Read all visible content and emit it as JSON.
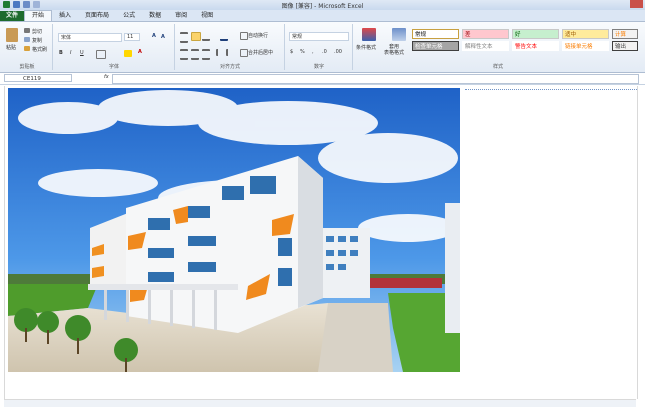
{
  "window": {
    "title": "图像 [兼容] - Microsoft Excel"
  },
  "tabs": [
    "文件",
    "开始",
    "插入",
    "页面布局",
    "公式",
    "数据",
    "审阅",
    "视图"
  ],
  "ribbon": {
    "clipboard": {
      "paste": "粘贴",
      "cut": "剪切",
      "copy": "复制",
      "format_painter": "格式刷",
      "label": "剪贴板"
    },
    "font": {
      "name": "宋体",
      "size": "11",
      "label": "字体"
    },
    "alignment": {
      "wrap": "自动换行",
      "merge": "合并后居中",
      "label": "对齐方式"
    },
    "number": {
      "format": "常规",
      "label": "数字"
    },
    "styles": {
      "conditional": "条件格式",
      "table": "套用\n表格格式",
      "cells": [
        {
          "text": "常规",
          "bg": "#ffffff",
          "fg": "#000000",
          "border": "#c8a040"
        },
        {
          "text": "差",
          "bg": "#ffc7ce",
          "fg": "#9c0006",
          "border": "#c8c8c8"
        },
        {
          "text": "好",
          "bg": "#c6efce",
          "fg": "#006100",
          "border": "#c8c8c8"
        },
        {
          "text": "适中",
          "bg": "#ffeb9c",
          "fg": "#9c5700",
          "border": "#c8c8c8"
        },
        {
          "text": "计算",
          "bg": "#f2f2f2",
          "fg": "#fa7d00",
          "border": "#7f7f7f"
        },
        {
          "text": "检查单元格",
          "bg": "#a5a5a5",
          "fg": "#ffffff",
          "border": "#3f3f3f"
        },
        {
          "text": "解释性文本",
          "bg": "#ffffff",
          "fg": "#7f7f7f",
          "border": "#ffffff"
        },
        {
          "text": "警告文本",
          "bg": "#ffffff",
          "fg": "#ff0000",
          "border": "#ffffff"
        },
        {
          "text": "链接单元格",
          "bg": "#ffffff",
          "fg": "#fa7d00",
          "border": "#ffffff"
        },
        {
          "text": "输出",
          "bg": "#f2f2f2",
          "fg": "#3f3f3f",
          "border": "#3f3f3f"
        }
      ],
      "label": "样式"
    }
  },
  "formula_bar": {
    "cell": "CE119",
    "fx": "fx",
    "value": ""
  },
  "colors": {
    "file_tab": "#1e6b2d",
    "accent": "#2b579a"
  }
}
